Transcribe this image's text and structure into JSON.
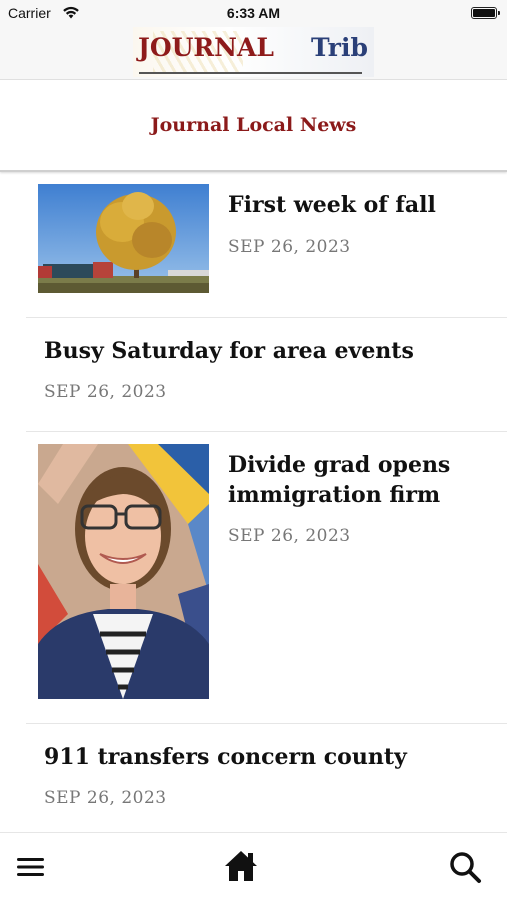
{
  "status_bar": {
    "carrier": "Carrier",
    "time": "6:33 AM"
  },
  "header": {
    "logo_part1": "JOURNAL",
    "logo_part2": "Trib",
    "section_title": "Journal Local News"
  },
  "articles": [
    {
      "headline": "First week of fall",
      "date": "SEP 26, 2023",
      "has_image": true,
      "image": "tree-photo"
    },
    {
      "headline": "Busy Saturday for area events",
      "date": "SEP 26, 2023",
      "has_image": false
    },
    {
      "headline_line1": "Divide grad opens",
      "headline_line2": "immigration firm",
      "date": "SEP 26, 2023",
      "has_image": true,
      "image": "portrait-photo"
    },
    {
      "headline": "911 transfers concern county",
      "date": "SEP 26, 2023",
      "has_image": false
    }
  ],
  "tab_bar": {
    "menu_icon": "hamburger-menu-icon",
    "home_icon": "home-icon",
    "search_icon": "search-icon"
  },
  "colors": {
    "brand_red": "#8b1a1a",
    "brand_blue": "#2a3f78",
    "date_gray": "#777777"
  }
}
